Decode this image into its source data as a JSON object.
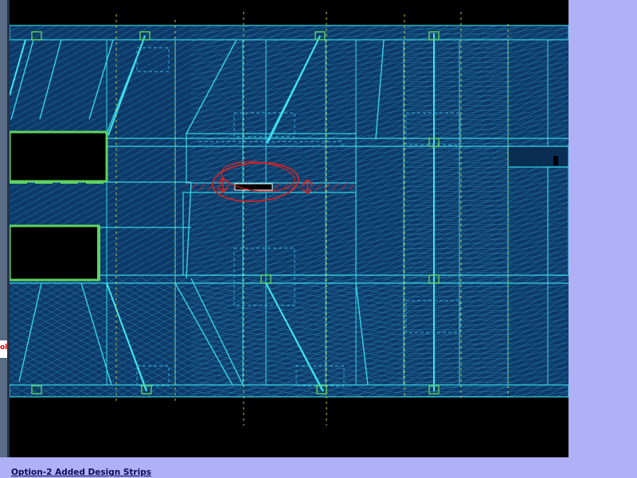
{
  "caption": "Option-2 Added Design Strips",
  "side_marker": "ol",
  "colors": {
    "background": "#b0b0f6",
    "canvas": "#000000",
    "panel_fill": "#0d3a6a",
    "line_cyan": "#34d5e6",
    "line_green": "#5fd35f",
    "markup_red": "#e0201e",
    "guide_yellow": "#d8d840"
  },
  "icons": [
    "markup-circle-icon",
    "dimension-arrow-icon",
    "opening-block-icon"
  ]
}
